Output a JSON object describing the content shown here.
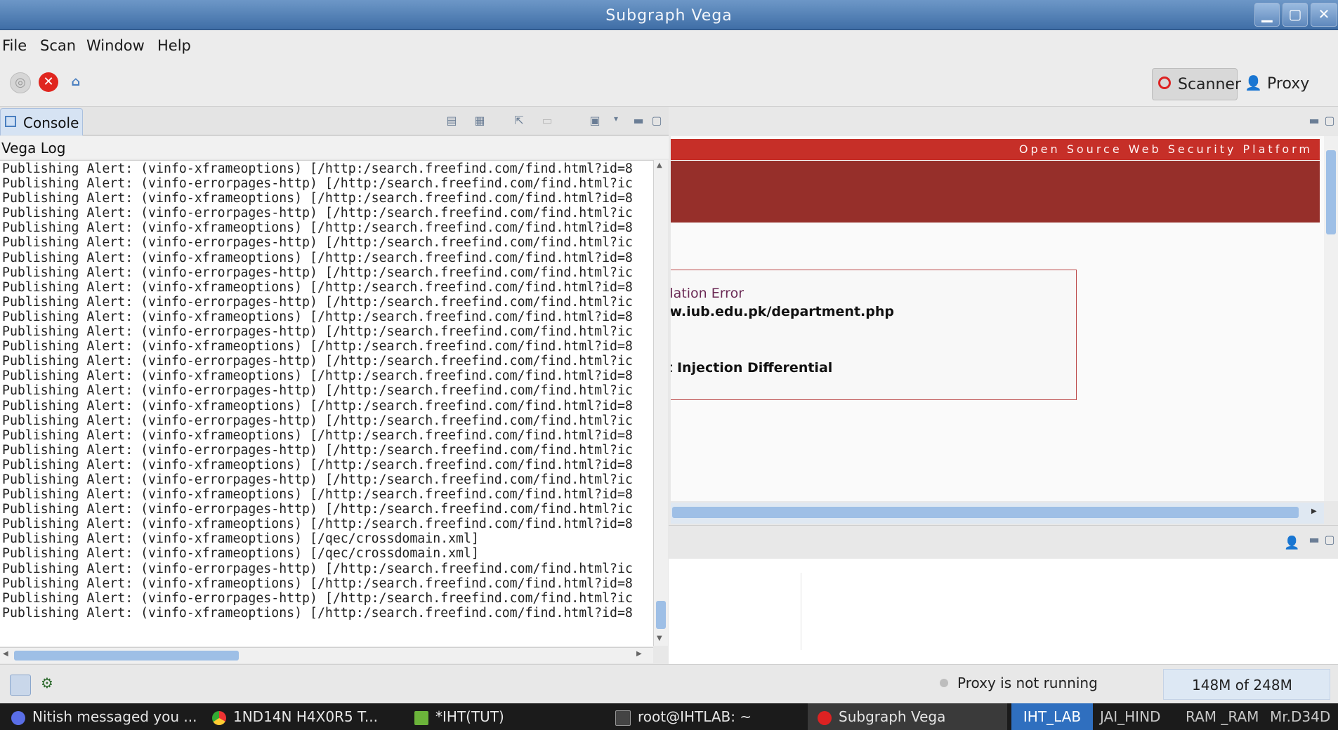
{
  "window": {
    "title": "Subgraph Vega"
  },
  "menu": [
    "File",
    "Scan",
    "Window",
    "Help"
  ],
  "perspectives": {
    "scanner_label": "Scanner",
    "proxy_label": "Proxy"
  },
  "console": {
    "tab_label": "Console",
    "log_title": "Vega Log",
    "lines": [
      "Publishing Alert: (vinfo-xframeoptions) [/http:/search.freefind.com/find.html?id=8",
      "Publishing Alert: (vinfo-errorpages-http) [/http:/search.freefind.com/find.html?ic",
      "Publishing Alert: (vinfo-xframeoptions) [/http:/search.freefind.com/find.html?id=8",
      "Publishing Alert: (vinfo-errorpages-http) [/http:/search.freefind.com/find.html?ic",
      "Publishing Alert: (vinfo-xframeoptions) [/http:/search.freefind.com/find.html?id=8",
      "Publishing Alert: (vinfo-errorpages-http) [/http:/search.freefind.com/find.html?ic",
      "Publishing Alert: (vinfo-xframeoptions) [/http:/search.freefind.com/find.html?id=8",
      "Publishing Alert: (vinfo-errorpages-http) [/http:/search.freefind.com/find.html?ic",
      "Publishing Alert: (vinfo-xframeoptions) [/http:/search.freefind.com/find.html?id=8",
      "Publishing Alert: (vinfo-errorpages-http) [/http:/search.freefind.com/find.html?ic",
      "Publishing Alert: (vinfo-xframeoptions) [/http:/search.freefind.com/find.html?id=8",
      "Publishing Alert: (vinfo-errorpages-http) [/http:/search.freefind.com/find.html?ic",
      "Publishing Alert: (vinfo-xframeoptions) [/http:/search.freefind.com/find.html?id=8",
      "Publishing Alert: (vinfo-errorpages-http) [/http:/search.freefind.com/find.html?ic",
      "Publishing Alert: (vinfo-xframeoptions) [/http:/search.freefind.com/find.html?id=8",
      "Publishing Alert: (vinfo-errorpages-http) [/http:/search.freefind.com/find.html?ic",
      "Publishing Alert: (vinfo-xframeoptions) [/http:/search.freefind.com/find.html?id=8",
      "Publishing Alert: (vinfo-errorpages-http) [/http:/search.freefind.com/find.html?ic",
      "Publishing Alert: (vinfo-xframeoptions) [/http:/search.freefind.com/find.html?id=8",
      "Publishing Alert: (vinfo-errorpages-http) [/http:/search.freefind.com/find.html?ic",
      "Publishing Alert: (vinfo-xframeoptions) [/http:/search.freefind.com/find.html?id=8",
      "Publishing Alert: (vinfo-errorpages-http) [/http:/search.freefind.com/find.html?ic",
      "Publishing Alert: (vinfo-xframeoptions) [/http:/search.freefind.com/find.html?id=8",
      "Publishing Alert: (vinfo-errorpages-http) [/http:/search.freefind.com/find.html?ic",
      "Publishing Alert: (vinfo-xframeoptions) [/http:/search.freefind.com/find.html?id=8",
      "Publishing Alert: (vinfo-xframeoptions) [/qec/crossdomain.xml]",
      "Publishing Alert: (vinfo-xframeoptions) [/qec/crossdomain.xml]",
      "Publishing Alert: (vinfo-errorpages-http) [/http:/search.freefind.com/find.html?ic",
      "Publishing Alert: (vinfo-xframeoptions) [/http:/search.freefind.com/find.html?id=8",
      "Publishing Alert: (vinfo-errorpages-http) [/http:/search.freefind.com/find.html?ic",
      "Publishing Alert: (vinfo-xframeoptions) [/http:/search.freefind.com/find.html?id=8"
    ]
  },
  "browser": {
    "banner_tagline": "Open Source Web Security Platform",
    "alert_title": "lidation Error",
    "alert_url": "ww.iub.edu.pk/department.php",
    "alert_check": "xt Injection Differential"
  },
  "status": {
    "proxy": "Proxy is not running",
    "memory": "148M of 248M"
  },
  "taskbar": {
    "items": [
      "Nitish messaged you ...",
      "1ND14N H4X0R5 T...",
      "*IHT(TUT)",
      "root@IHTLAB: ~",
      "Subgraph Vega"
    ],
    "workspaces": [
      "IHT_LAB",
      "JAI_HIND",
      "RAM _RAM",
      "Mr.D34D"
    ]
  },
  "colors": {
    "accent_red": "#c62f28",
    "banner_dark": "#962f2a",
    "selection_blue": "#9ebfe6"
  }
}
